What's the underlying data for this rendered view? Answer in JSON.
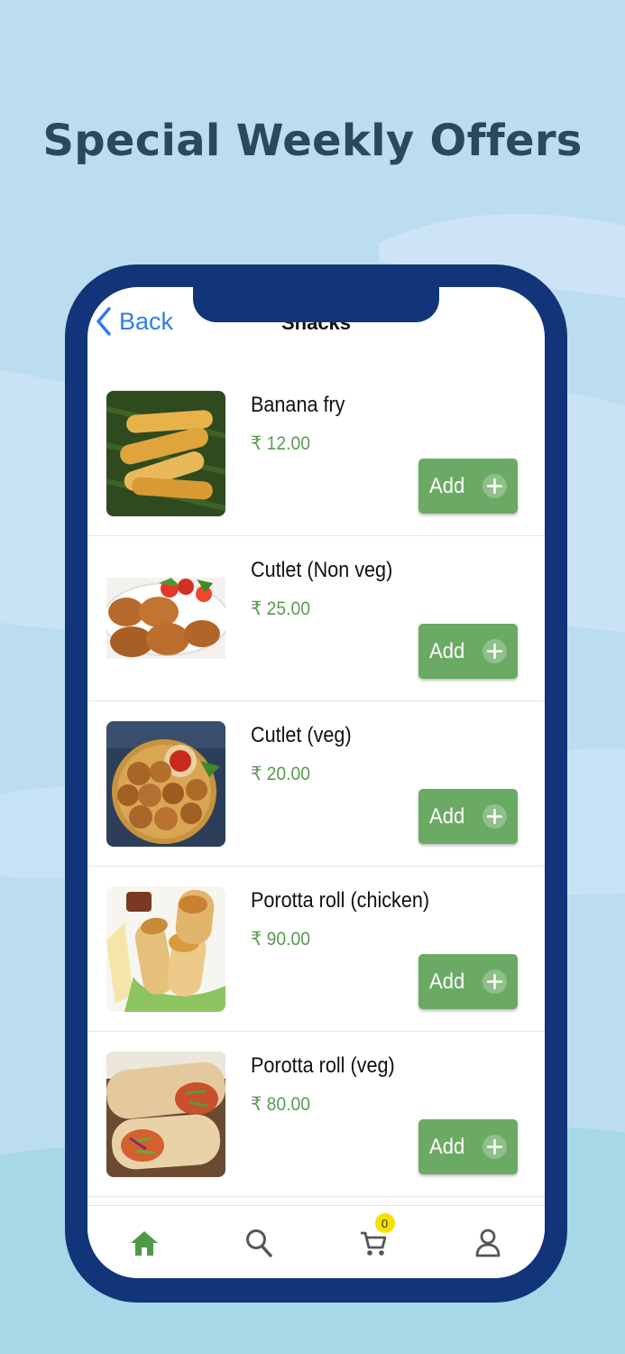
{
  "headline": "Special Weekly Offers",
  "nav": {
    "back_label": "Back",
    "title": "Snacks"
  },
  "currency": "₹",
  "add_label": "Add",
  "items": [
    {
      "name": "Banana fry",
      "price": "₹ 12.00"
    },
    {
      "name": "Cutlet (Non veg)",
      "price": "₹ 25.00"
    },
    {
      "name": "Cutlet (veg)",
      "price": "₹ 20.00"
    },
    {
      "name": "Porotta roll (chicken)",
      "price": "₹ 90.00"
    },
    {
      "name": "Porotta roll (veg)",
      "price": "₹ 80.00"
    }
  ],
  "tabbar": {
    "tabs": [
      {
        "icon": "home-icon",
        "active": true
      },
      {
        "icon": "search-icon",
        "active": false
      },
      {
        "icon": "cart-icon",
        "active": false,
        "badge": "0"
      },
      {
        "icon": "profile-icon",
        "active": false
      }
    ]
  },
  "colors": {
    "background": "#bcdcf0",
    "phone_frame": "#12357a",
    "accent_green": "#6aaa64",
    "price_green": "#5a9a52",
    "link_blue": "#2f7de8",
    "badge_yellow": "#f5e100"
  }
}
